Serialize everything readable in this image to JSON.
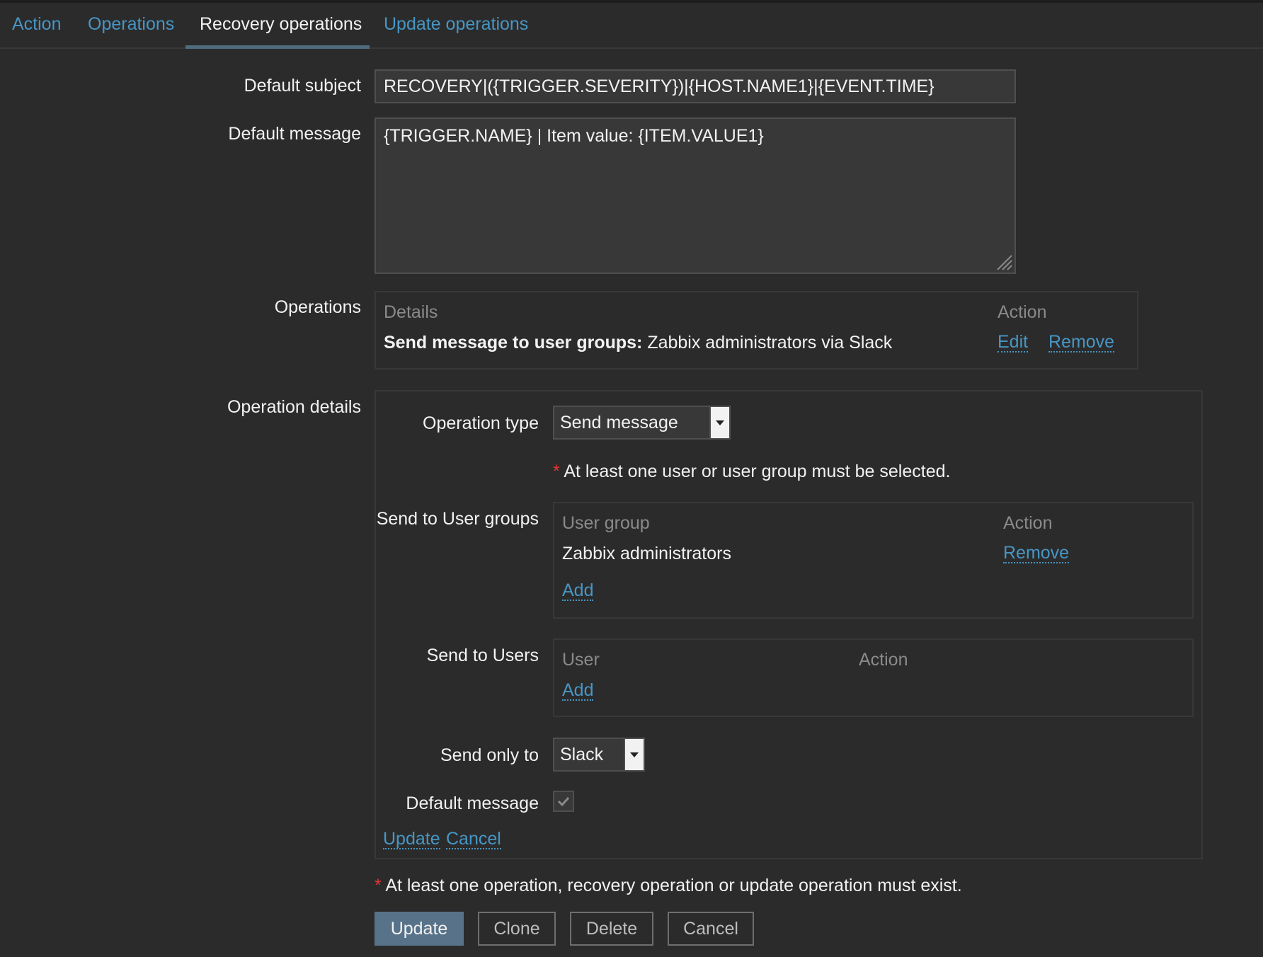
{
  "tabs": [
    {
      "label": "Action"
    },
    {
      "label": "Operations"
    },
    {
      "label": "Recovery operations"
    },
    {
      "label": "Update operations"
    }
  ],
  "form": {
    "default_subject_label": "Default subject",
    "default_subject_value": "RECOVERY|({TRIGGER.SEVERITY})|{HOST.NAME1}|{EVENT.TIME}",
    "default_message_label": "Default message",
    "default_message_value": "{TRIGGER.NAME} | Item value: {ITEM.VALUE1}",
    "operations_label": "Operations",
    "operation_details_label": "Operation details"
  },
  "operations_table": {
    "col_details": "Details",
    "col_action": "Action",
    "row": {
      "details_bold": "Send message to user groups:",
      "details_rest": " Zabbix administrators via Slack",
      "edit": "Edit",
      "remove": "Remove"
    }
  },
  "operation_details": {
    "operation_type_label": "Operation type",
    "operation_type_value": "Send message",
    "user_required_note": "At least one user or user group must be selected.",
    "send_to_user_groups_label": "Send to User groups",
    "user_groups": {
      "col_group": "User group",
      "col_action": "Action",
      "rows": [
        {
          "name": "Zabbix administrators",
          "action": "Remove"
        }
      ],
      "add": "Add"
    },
    "send_to_users_label": "Send to Users",
    "users": {
      "col_user": "User",
      "col_action": "Action",
      "add": "Add"
    },
    "send_only_to_label": "Send only to",
    "send_only_to_value": "Slack",
    "default_message_label": "Default message",
    "default_message_checked": true,
    "update_link": "Update",
    "cancel_link": "Cancel"
  },
  "footer": {
    "operation_required_note": "At least one operation, recovery operation or update operation must exist.",
    "buttons": {
      "update": "Update",
      "clone": "Clone",
      "delete": "Delete",
      "cancel": "Cancel"
    }
  },
  "colors": {
    "background": "#2b2b2b",
    "link": "#4796c4",
    "required": "#e33734",
    "primary_button": "#587389"
  }
}
